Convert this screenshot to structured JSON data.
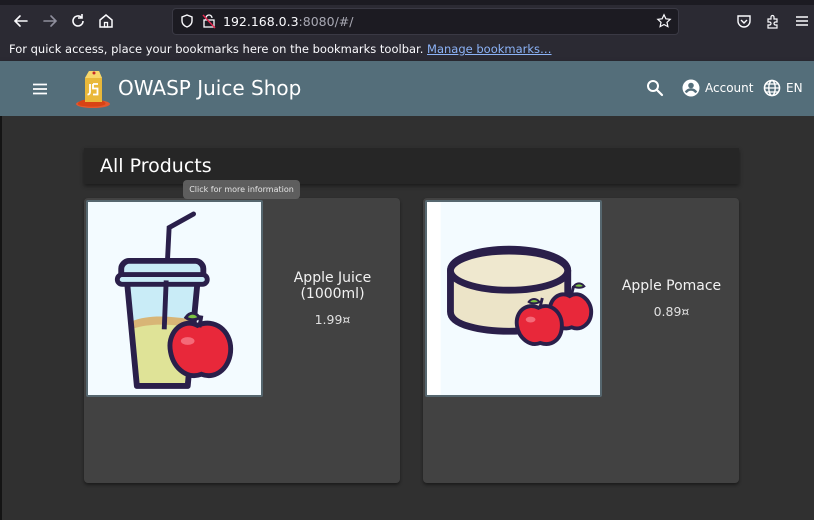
{
  "browser": {
    "url_host": "192.168.0.3",
    "url_rest": ":8080/#/",
    "bookmarks_hint": "For quick access, place your bookmarks here on the bookmarks toolbar.",
    "manage_bookmarks": "Manage bookmarks…",
    "icons": [
      "back-icon",
      "forward-icon",
      "reload-icon",
      "home-icon",
      "shield-icon",
      "insecure-lock-icon",
      "bookmark-star-icon",
      "pocket-icon",
      "extensions-icon",
      "app-menu-icon"
    ]
  },
  "app": {
    "title": "OWASP Juice Shop",
    "account_label": "Account",
    "language_label": "EN",
    "toolbar_color": "#546e7a"
  },
  "main": {
    "heading": "All Products",
    "tooltip": "Click for more information",
    "products": [
      {
        "name": "Apple Juice (1000ml)",
        "price": "1.99¤"
      },
      {
        "name": "Apple Pomace",
        "price": "0.89¤"
      }
    ]
  }
}
